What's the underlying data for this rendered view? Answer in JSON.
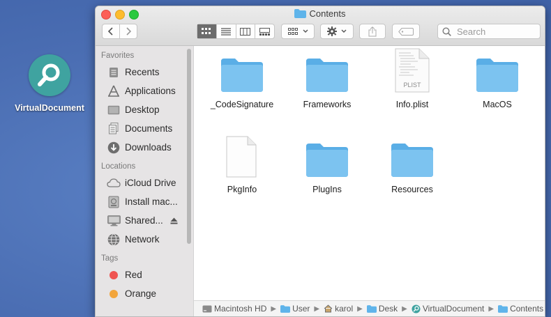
{
  "desktop": {
    "icon_label": "VirtualDocument",
    "icon_color": "#3fa3a0"
  },
  "window": {
    "title": "Contents"
  },
  "toolbar": {
    "search_placeholder": "Search"
  },
  "sidebar": {
    "favorites_header": "Favorites",
    "favorites": [
      {
        "label": "Recents",
        "icon": "recents-icon"
      },
      {
        "label": "Applications",
        "icon": "applications-icon"
      },
      {
        "label": "Desktop",
        "icon": "desktop-icon"
      },
      {
        "label": "Documents",
        "icon": "documents-icon"
      },
      {
        "label": "Downloads",
        "icon": "downloads-icon"
      }
    ],
    "locations_header": "Locations",
    "locations": [
      {
        "label": "iCloud Drive",
        "icon": "cloud-icon"
      },
      {
        "label": "Install mac...",
        "icon": "disk-icon"
      },
      {
        "label": "Shared...",
        "icon": "display-icon"
      },
      {
        "label": "Network",
        "icon": "network-icon"
      }
    ],
    "tags_header": "Tags",
    "tags": [
      {
        "label": "Red",
        "color": "#ef5350"
      },
      {
        "label": "Orange",
        "color": "#f2a53c"
      }
    ]
  },
  "files": [
    {
      "name": "_CodeSignature",
      "kind": "folder"
    },
    {
      "name": "Frameworks",
      "kind": "folder"
    },
    {
      "name": "Info.plist",
      "kind": "plist",
      "badge": "PLIST"
    },
    {
      "name": "MacOS",
      "kind": "folder"
    },
    {
      "name": "PkgInfo",
      "kind": "document"
    },
    {
      "name": "PlugIns",
      "kind": "folder"
    },
    {
      "name": "Resources",
      "kind": "folder"
    }
  ],
  "pathbar": [
    {
      "label": "Macintosh HD",
      "icon": "hard-drive-icon"
    },
    {
      "label": "User",
      "icon": "folder-icon"
    },
    {
      "label": "karol",
      "icon": "home-icon"
    },
    {
      "label": "Desk",
      "icon": "folder-icon"
    },
    {
      "label": "VirtualDocument",
      "icon": "app-icon"
    },
    {
      "label": "Contents",
      "icon": "folder-icon"
    }
  ]
}
